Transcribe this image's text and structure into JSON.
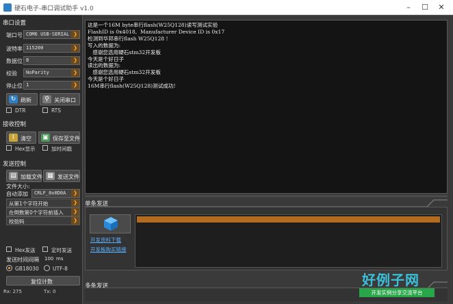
{
  "window": {
    "title": "硬石电子-串口调试助手 v1.0"
  },
  "sidebar": {
    "serial_settings": {
      "heading": "串口设置",
      "port": {
        "label": "端口号",
        "value": "COM6 USB-SERIAL"
      },
      "baud": {
        "label": "波特率",
        "value": "115200"
      },
      "databits": {
        "label": "数据位",
        "value": "8"
      },
      "parity": {
        "label": "校验",
        "value": "NoParity"
      },
      "stopbits": {
        "label": "停止位",
        "value": "1"
      },
      "refresh_label": "刷新",
      "close_port_label": "关闭串口",
      "dtr_label": "DTR",
      "rts_label": "RTS"
    },
    "receive_control": {
      "heading": "接收控制",
      "clear_label": "清空",
      "save_file_label": "保存至文件",
      "hex_display_label": "Hex显示",
      "timestamp_label": "加时间戳"
    },
    "send_control": {
      "heading": "发送控制",
      "load_file_label": "加载文件",
      "send_file_label": "发送文件",
      "file_size_label": "文件大小:",
      "auto_add_label": "自动添加",
      "auto_add_value": "CRLF_0x0D0A",
      "start_char_value": "从第1个字符开始",
      "insert_value": "在倒数第0个字符前插入",
      "checksum_value": "校验码",
      "hex_send_label": "Hex发送",
      "timed_send_label": "定时发送",
      "interval_label": "发送时间间隔",
      "interval_value": "100",
      "interval_unit": "ms",
      "encoding_gb": "GB18030",
      "encoding_utf": "UTF-8",
      "reset_count_label": "复位计数"
    },
    "status": {
      "rx": "Rx: 275",
      "tx": "Tx: 0"
    }
  },
  "receive": {
    "lines": [
      "这是一个16M byte串行flash(W25Q128)读写测试实验",
      "FlashID is 0x4018,  Manufacturer Device ID is 0x17",
      "检测到华邦串行flash W25Q128 !",
      "写入的数据为:",
      "   感谢您选用硬石stm32开发板",
      "今天是个好日子",
      "读出的数据为:",
      "   感谢您选用硬石stm32开发板",
      "今天是个好日子",
      "16M串行flash(W25Q128)测试成功!"
    ]
  },
  "single_send": {
    "heading": "单条发送",
    "link_download": "开发资料下载",
    "link_buy": "开发板购买链接"
  },
  "multi_send": {
    "heading": "多条发送"
  },
  "watermark": {
    "big": "好例子网",
    "small": "开发实例分享交流平台"
  },
  "colors": {
    "accent": "#b36b1f",
    "link": "#5ab0ff"
  }
}
